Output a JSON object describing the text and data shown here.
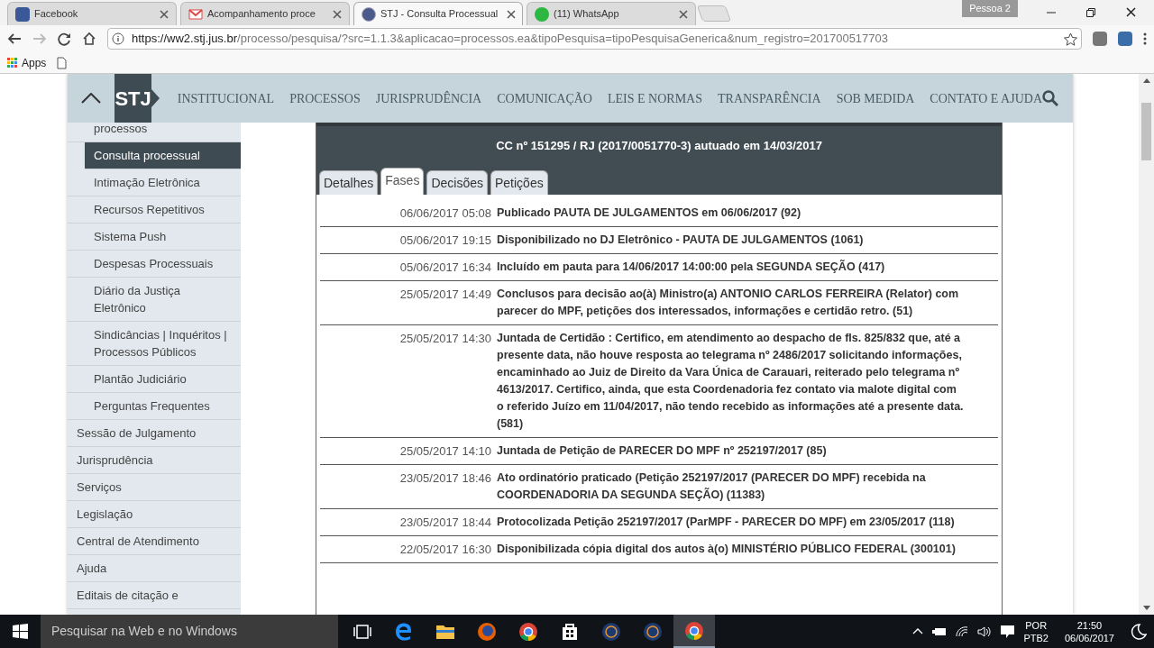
{
  "browser": {
    "tabs": [
      {
        "title": "Facebook",
        "selected": false
      },
      {
        "title": "Acompanhamento proce",
        "selected": false
      },
      {
        "title": "STJ - Consulta Processual",
        "selected": true
      },
      {
        "title": "(11) WhatsApp",
        "selected": false
      }
    ],
    "profile": "Pessoa 2",
    "url_host": "https://ww2.stj.jus.br",
    "url_path": "/processo/pesquisa/?src=1.1.3&aplicacao=processos.ea&tipoPesquisa=tipoPesquisaGenerica&num_registro=201700517703",
    "bookmarks": [
      "Apps"
    ]
  },
  "nav": {
    "logo": "STJ",
    "items": [
      "INSTITUCIONAL",
      "PROCESSOS",
      "JURISPRUDÊNCIA",
      "COMUNICAÇÃO",
      "LEIS E NORMAS",
      "TRANSPARÊNCIA",
      "SOB MEDIDA",
      "CONTATO E AJUDA"
    ]
  },
  "sidebar": {
    "items": [
      {
        "label": "processos",
        "kind": "sub",
        "selected": false
      },
      {
        "label": "Consulta processual",
        "kind": "sub",
        "selected": true
      },
      {
        "label": "Intimação Eletrônica",
        "kind": "sub",
        "selected": false
      },
      {
        "label": "Recursos Repetitivos",
        "kind": "sub",
        "selected": false
      },
      {
        "label": "Sistema Push",
        "kind": "sub",
        "selected": false
      },
      {
        "label": "Despesas Processuais",
        "kind": "sub",
        "selected": false
      },
      {
        "label": "Diário da Justiça Eletrônico",
        "kind": "sub",
        "selected": false
      },
      {
        "label": "Sindicâncias | Inquéritos | Processos Públicos",
        "kind": "sub",
        "selected": false
      },
      {
        "label": "Plantão Judiciário",
        "kind": "sub",
        "selected": false
      },
      {
        "label": "Perguntas Frequentes",
        "kind": "sub",
        "selected": false
      },
      {
        "label": "Sessão de Julgamento",
        "kind": "top",
        "selected": false
      },
      {
        "label": "Jurisprudência",
        "kind": "top",
        "selected": false
      },
      {
        "label": "Serviços",
        "kind": "top",
        "selected": false
      },
      {
        "label": "Legislação",
        "kind": "top",
        "selected": false
      },
      {
        "label": "Central de Atendimento",
        "kind": "top",
        "selected": false
      },
      {
        "label": "Ajuda",
        "kind": "top",
        "selected": false
      },
      {
        "label": "Editais de citação e",
        "kind": "top",
        "selected": false
      }
    ]
  },
  "process": {
    "title": "CC nº 151295 / RJ (2017/0051770-3) autuado em 14/03/2017",
    "tabs": [
      {
        "label": "Detalhes",
        "selected": false
      },
      {
        "label": "Fases",
        "selected": true
      },
      {
        "label": "Decisões",
        "selected": false
      },
      {
        "label": "Petições",
        "selected": false
      }
    ],
    "phases": [
      {
        "date": "06/06/2017 05:08",
        "text": "Publicado PAUTA DE JULGAMENTOS em 06/06/2017 (92)"
      },
      {
        "date": "05/06/2017 19:15",
        "text": "Disponibilizado no DJ Eletrônico - PAUTA DE JULGAMENTOS (1061)"
      },
      {
        "date": "05/06/2017 16:34",
        "text": "Incluído em pauta para 14/06/2017 14:00:00 pela SEGUNDA SEÇÃO (417)"
      },
      {
        "date": "25/05/2017 14:49",
        "text": "Conclusos para decisão ao(à) Ministro(a) ANTONIO CARLOS FERREIRA (Relator) com parecer do MPF, petições dos interessados, informações e certidão retro. (51)"
      },
      {
        "date": "25/05/2017 14:30",
        "text": "Juntada de Certidão : Certifico, em atendimento ao despacho de fls. 825/832 que, até a presente data, não houve resposta ao telegrama nº 2486/2017 solicitando informações, encaminhado ao Juiz de Direito da Vara Única de Carauari, reiterado pelo telegrama nº 4613/2017. Certifico, ainda, que esta Coordenadoria fez contato via malote digital com o referido Juízo em 11/04/2017, não tendo recebido as informações até a presente data. (581)"
      },
      {
        "date": "25/05/2017 14:10",
        "text": "Juntada de Petição de PARECER DO MPF nº 252197/2017 (85)"
      },
      {
        "date": "23/05/2017 18:46",
        "text": "Ato ordinatório praticado (Petição 252197/2017 (PARECER DO MPF) recebida na COORDENADORIA DA SEGUNDA SEÇÃO) (11383)"
      },
      {
        "date": "23/05/2017 18:44",
        "text": "Protocolizada Petição 252197/2017 (ParMPF - PARECER DO MPF) em 23/05/2017 (118)"
      },
      {
        "date": "22/05/2017 16:30",
        "text": "Disponibilizada cópia digital dos autos à(o) MINISTÉRIO PÚBLICO FEDERAL (300101)"
      }
    ]
  },
  "taskbar": {
    "search_placeholder": "Pesquisar na Web e no Windows",
    "apps": [
      {
        "selected": false
      },
      {
        "selected": false
      },
      {
        "selected": false
      },
      {
        "selected": false
      },
      {
        "selected": false
      },
      {
        "selected": false
      },
      {
        "selected": false
      },
      {
        "selected": false
      },
      {
        "selected": true
      }
    ],
    "language": "POR",
    "layout": "PTB2",
    "time": "21:50",
    "date": "06/06/2017"
  }
}
